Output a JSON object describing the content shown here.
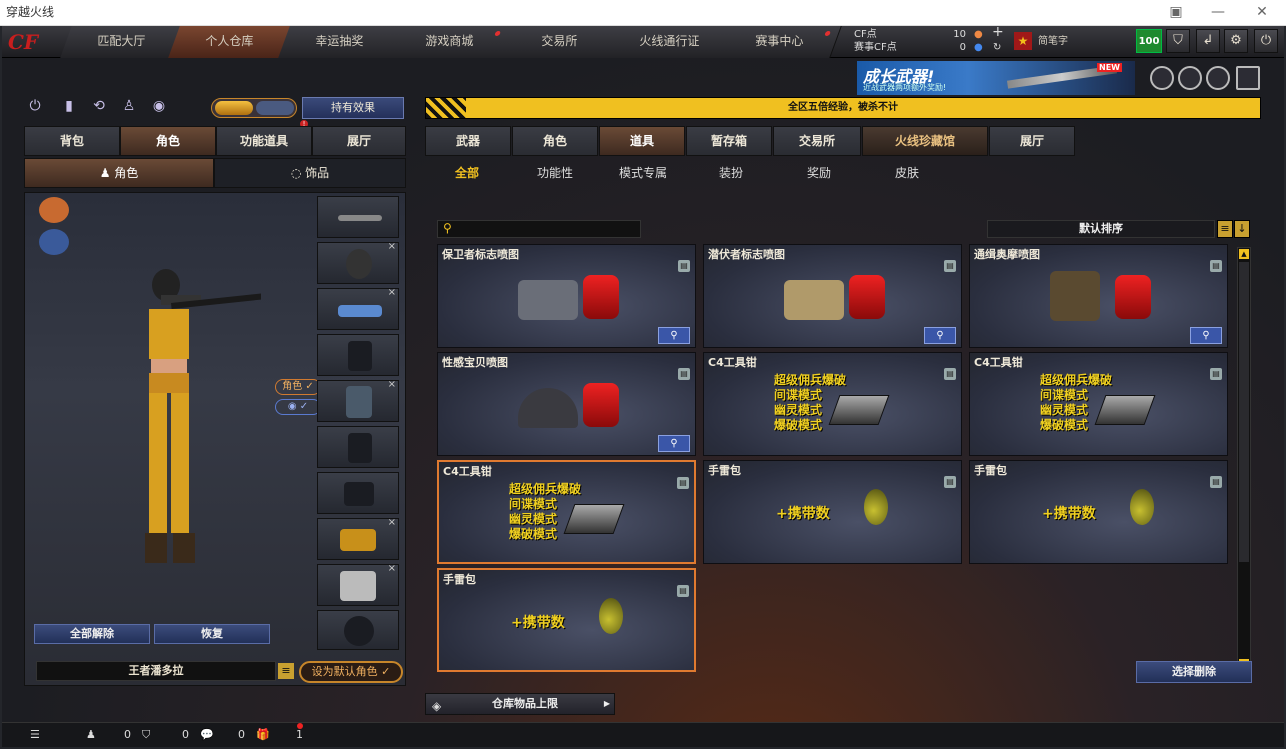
{
  "window": {
    "title": "穿越火线"
  },
  "topnav": {
    "items": [
      {
        "label": "匹配大厅"
      },
      {
        "label": "个人仓库"
      },
      {
        "label": "幸运抽奖"
      },
      {
        "label": "游戏商城"
      },
      {
        "label": "交易所"
      },
      {
        "label": "火线通行证"
      },
      {
        "label": "赛事中心"
      }
    ],
    "active_index": 1,
    "cf_label": "CF点",
    "cf_value": "10",
    "match_cf_label": "赛事CF点",
    "match_cf_value": "0",
    "username": "简笔字",
    "level": "100"
  },
  "banner": {
    "title": "成长武器!",
    "subtitle": "近战武器两项额外奖励!",
    "badge": "NEW"
  },
  "left": {
    "effect_button": "持有效果",
    "tabs": [
      "背包",
      "角色",
      "功能道具",
      "展厅"
    ],
    "active_tab": 1,
    "subtabs": [
      "角色",
      "饰品"
    ],
    "role_chip": "角色",
    "unequip_all": "全部解除",
    "restore": "恢复",
    "character_name": "王者潘多拉",
    "set_default": "设为默认角色"
  },
  "notice": "全区五倍经验，被杀不计",
  "right": {
    "tabs": [
      "武器",
      "角色",
      "道具",
      "暂存箱",
      "交易所",
      "火线珍藏馆",
      "展厅"
    ],
    "active_tab": 2,
    "subtabs": [
      "全部",
      "功能性",
      "模式专属",
      "装扮",
      "奖励",
      "皮肤"
    ],
    "sort_label": "默认排序",
    "items": [
      {
        "name": "保卫者标志喷图"
      },
      {
        "name": "潜伏者标志喷图"
      },
      {
        "name": "通缉奥摩喷图"
      },
      {
        "name": "性感宝贝喷图"
      },
      {
        "name": "C4工具钳",
        "modes": [
          "超级佣兵爆破",
          "间谍模式",
          "幽灵模式",
          "爆破模式"
        ]
      },
      {
        "name": "C4工具钳",
        "modes": [
          "超级佣兵爆破",
          "间谍模式",
          "幽灵模式",
          "爆破模式"
        ]
      },
      {
        "name": "C4工具钳",
        "modes": [
          "超级佣兵爆破",
          "间谍模式",
          "幽灵模式",
          "爆破模式"
        ]
      },
      {
        "name": "手雷包",
        "carry": "+携带数"
      },
      {
        "name": "手雷包",
        "carry": "+携带数"
      },
      {
        "name": "手雷包",
        "carry": "+携带数"
      }
    ],
    "delete_button": "选择删除",
    "capacity_label": "仓库物品上限"
  },
  "bottom": {
    "friends": "0",
    "shield": "0",
    "chat": "0",
    "gift": "1"
  }
}
